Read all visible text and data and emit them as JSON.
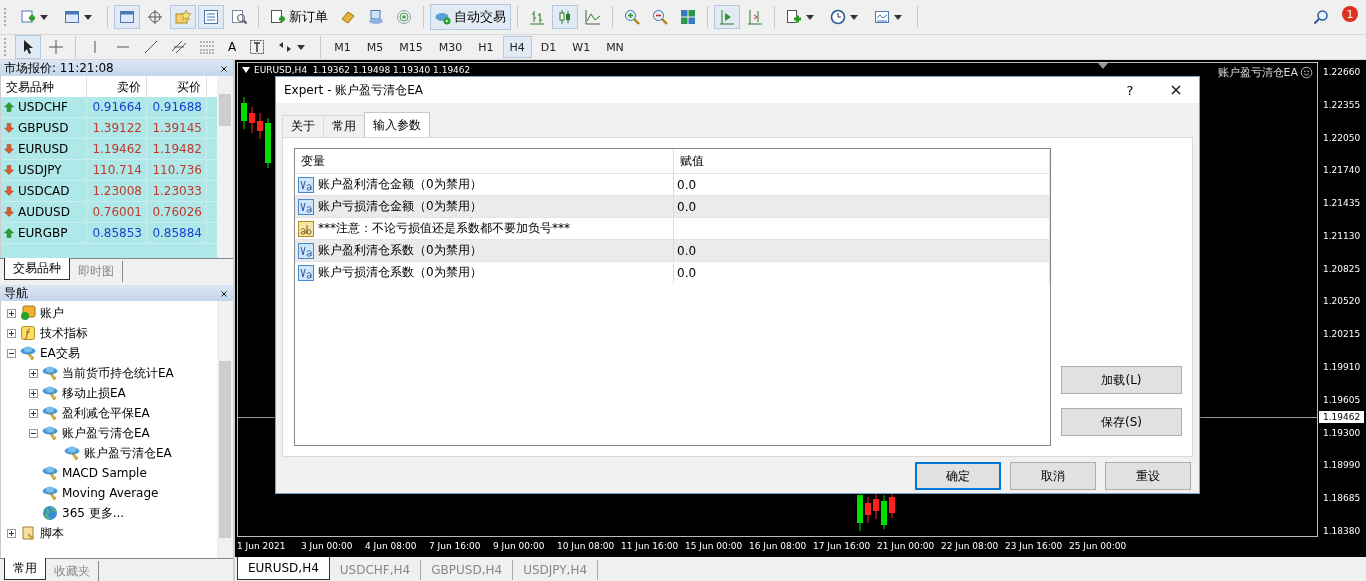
{
  "toolbar": {
    "new_order": "新订单",
    "autotrading": {
      "label": "自动交易",
      "on": true
    },
    "chart_types": [
      {
        "selected": false
      },
      {
        "selected": true
      },
      {
        "selected": false
      }
    ],
    "autoscroll": true,
    "notifications": "1"
  },
  "tools": {
    "text_tool": "A",
    "timeframes": [
      {
        "label": "M1",
        "selected": false
      },
      {
        "label": "M5",
        "selected": false
      },
      {
        "label": "M15",
        "selected": false
      },
      {
        "label": "M30",
        "selected": false
      },
      {
        "label": "H1",
        "selected": false
      },
      {
        "label": "H4",
        "selected": true
      },
      {
        "label": "D1",
        "selected": false
      },
      {
        "label": "W1",
        "selected": false
      },
      {
        "label": "MN",
        "selected": false
      }
    ]
  },
  "market_watch": {
    "title": "市场报价: 11:21:08",
    "columns": [
      "交易品种",
      "卖价",
      "买价"
    ],
    "rows": [
      {
        "symbol": "USDCHF",
        "bid": "0.91664",
        "ask": "0.91688",
        "rising": true
      },
      {
        "symbol": "GBPUSD",
        "bid": "1.39122",
        "ask": "1.39145",
        "rising": false
      },
      {
        "symbol": "EURUSD",
        "bid": "1.19462",
        "ask": "1.19482",
        "rising": false
      },
      {
        "symbol": "USDJPY",
        "bid": "110.714",
        "ask": "110.736",
        "rising": false
      },
      {
        "symbol": "USDCAD",
        "bid": "1.23008",
        "ask": "1.23033",
        "rising": false
      },
      {
        "symbol": "AUDUSD",
        "bid": "0.76001",
        "ask": "0.76026",
        "rising": false
      },
      {
        "symbol": "EURGBP",
        "bid": "0.85853",
        "ask": "0.85884",
        "rising": true
      }
    ],
    "tabs": [
      {
        "label": "交易品种",
        "selected": true
      },
      {
        "label": "即时图",
        "selected": false
      }
    ]
  },
  "navigator": {
    "title": "导航",
    "tree": [
      {
        "label": "账户",
        "kind": "account",
        "expanded": false
      },
      {
        "label": "技术指标",
        "kind": "indicator",
        "expanded": false
      },
      {
        "label": "EA交易",
        "kind": "expert",
        "expanded": true,
        "children": [
          {
            "label": "当前货币持仓统计EA",
            "kind": "expert",
            "expanded": false
          },
          {
            "label": "移动止损EA",
            "kind": "expert",
            "expanded": false
          },
          {
            "label": "盈利减仓平保EA",
            "kind": "expert",
            "expanded": false
          },
          {
            "label": "账户盈亏清仓EA",
            "kind": "expert",
            "expanded": true,
            "children": [
              {
                "label": "账户盈亏清仓EA",
                "kind": "expert"
              }
            ]
          },
          {
            "label": "MACD Sample",
            "kind": "expert"
          },
          {
            "label": "Moving Average",
            "kind": "expert"
          },
          {
            "label": "365 更多...",
            "kind": "globe"
          }
        ]
      },
      {
        "label": "脚本",
        "kind": "script",
        "expanded": false
      }
    ],
    "tabs": [
      {
        "label": "常用",
        "selected": true
      },
      {
        "label": "收藏夹",
        "selected": false
      }
    ]
  },
  "chart": {
    "header": "EURUSD,H4  1.19362 1.19498 1.19340 1.19462",
    "ea_label": "账户盈亏清仓EA",
    "price_labels": [
      "1.22660",
      "1.22355",
      "1.22050",
      "1.21740",
      "1.21435",
      "1.21130",
      "1.20825",
      "1.20520",
      "1.20215",
      "1.19910",
      "1.19605",
      "1.19300",
      "1.18990",
      "1.18685",
      "1.18380"
    ],
    "current_price": "1.19462",
    "time_labels": [
      "1 Jun 2021",
      "3 Jun 00:00",
      "4 Jun 08:00",
      "7 Jun 16:00",
      "9 Jun 00:00",
      "10 Jun 08:00",
      "11 Jun 16:00",
      "15 Jun 00:00",
      "16 Jun 08:00",
      "17 Jun 16:00",
      "21 Jun 00:00",
      "22 Jun 08:00",
      "23 Jun 16:00",
      "25 Jun 00:00"
    ],
    "tabs": [
      {
        "label": "EURUSD,H4",
        "selected": true
      },
      {
        "label": "USDCHF,H4",
        "selected": false
      },
      {
        "label": "GBPUSD,H4",
        "selected": false
      },
      {
        "label": "USDJPY,H4",
        "selected": false
      }
    ]
  },
  "dialog": {
    "title": "Expert - 账户盈亏清仓EA",
    "help": "?",
    "tabs": [
      {
        "label": "关于",
        "selected": false
      },
      {
        "label": "常用",
        "selected": false
      },
      {
        "label": "输入参数",
        "selected": true
      }
    ],
    "columns": [
      "变量",
      "赋值"
    ],
    "rows": [
      {
        "kind": "number",
        "name": "账户盈利清仓金额（0为禁用）",
        "value": "0.0"
      },
      {
        "kind": "number",
        "name": "账户亏损清仓金额（0为禁用）",
        "value": "0.0"
      },
      {
        "kind": "string",
        "name": "***注意：不论亏损值还是系数都不要加负号***"
      },
      {
        "kind": "number",
        "name": "账户盈利清仓系数（0为禁用）",
        "value": "0.0"
      },
      {
        "kind": "number",
        "name": "账户亏损清仓系数（0为禁用）",
        "value": "0.0"
      }
    ],
    "side_buttons": [
      "加载(L)",
      "保存(S)"
    ],
    "buttons": [
      {
        "label": "确定",
        "default": true
      },
      {
        "label": "取消",
        "default": false
      },
      {
        "label": "重设",
        "default": false
      }
    ]
  }
}
